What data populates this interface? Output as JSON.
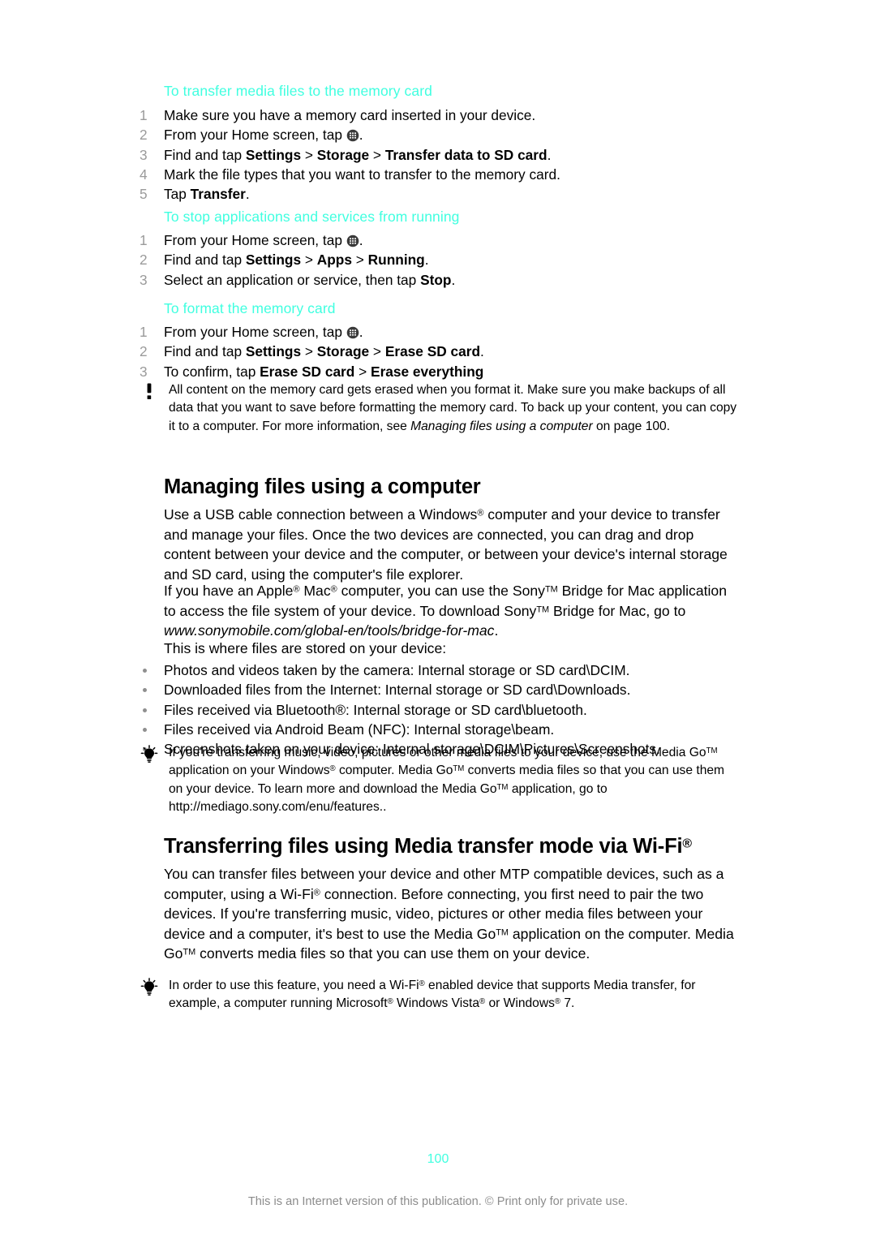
{
  "document": {
    "page_number": "100",
    "footer_note": "This is an Internet version of this publication. © Print only for private use.",
    "accent_color": "#40ffe0",
    "marker_color": "#9b9b9b"
  },
  "sections": [
    {
      "id": "transfer-media-files",
      "heading": "To transfer media files to the memory card",
      "type": "numbered",
      "steps": [
        {
          "num": "1",
          "text": "Make sure you have a memory card inserted in your device."
        },
        {
          "num": "2",
          "text": "From your Home screen, tap"
        },
        {
          "num": "3",
          "text": "Find and tap Settings > Storage > Transfer data to SD card."
        },
        {
          "num": "4",
          "text": "Mark the file types that you want to transfer to the memory card."
        },
        {
          "num": "5",
          "text": "Tap Transfer."
        }
      ]
    },
    {
      "id": "stop-applications",
      "heading": "To stop applications and services from running",
      "type": "numbered",
      "steps": [
        {
          "num": "1",
          "text": "From your Home screen, tap"
        },
        {
          "num": "2",
          "text": "Find and tap Settings > Apps > Running."
        },
        {
          "num": "3",
          "text": "Select an application or service, then tap Stop."
        }
      ]
    },
    {
      "id": "format-memory-card",
      "heading": "To format the memory card",
      "type": "numbered",
      "steps": [
        {
          "num": "1",
          "text": "From your Home screen, tap"
        },
        {
          "num": "2",
          "text": "Find and tap Settings > Storage > Erase SD card."
        },
        {
          "num": "3",
          "text": "To confirm, tap Erase SD card > Erase everything"
        }
      ]
    }
  ],
  "step_fragments": {
    "find_and_tap": "Find and tap ",
    "settings": "Settings",
    "storage": "Storage",
    "apps": "Apps",
    "running": "Running",
    "transfer_data_to_sd_card": "Transfer data to SD card",
    "erase_sd_card": "Erase SD card",
    "erase_everything": "Erase everything",
    "tap": "Tap ",
    "transfer": "Transfer",
    "from_home_screen": "From your Home screen, tap ",
    "period": ".",
    "separator": " > ",
    "select_app_prefix": "Select an application or service, then tap ",
    "stop": "Stop",
    "to_confirm_prefix": "To confirm, tap ",
    "make_sure_memory_card": "Make sure you have a memory card inserted in your device.",
    "mark_file_types": "Mark the file types that you want to transfer to the memory card."
  },
  "warning_note": {
    "icon": "exclamation-icon",
    "part1": "All content on the memory card gets erased when you format it. Make sure you make backups of all data that you want to save before formatting the memory card. To back up your content, you can copy it to a computer. For more information, see ",
    "italic": "Managing files using a computer",
    "part2": " on page 100."
  },
  "main_heading": "Managing files using a computer",
  "paragraphs": {
    "p1_a": "Use a USB cable connection between a Windows",
    "p1_b": " computer and your device to transfer and manage your files. Once the two devices are connected, you can drag and drop content between your device and the computer, or between your device's internal storage and SD card, using the computer's file explorer.",
    "p2_a": "If you have an Apple",
    "p2_b": " Mac",
    "p2_c": " computer, you can use the Sony",
    "p2_d": " Bridge for Mac application to access the file system of your device. To download Sony",
    "p2_e": " Bridge for Mac, go to ",
    "p2_url": "www.sonymobile.com/global-en/tools/bridge-for-mac",
    "p2_end": ".",
    "p3": "This is where files are stored on your device:"
  },
  "storage_bullets": [
    "Photos and videos taken by the camera: Internal storage or SD card\\DCIM.",
    "Downloaded files from the Internet: Internal storage or SD card\\Downloads.",
    "Files received via Bluetooth®: Internal storage or SD card\\bluetooth.",
    "Files received via Android Beam (NFC): Internal storage\\beam.",
    "Screenshots taken on your device: Internal storage\\DCIM\\Pictures\\Screenshots."
  ],
  "tip1": {
    "icon": "lightbulb-icon",
    "a": "If you're transferring music, video, pictures or other media files to your device, use the Media Go",
    "b": " application on your Windows",
    "c": " computer. Media Go",
    "d": " converts media files so that you can use them on your device. To learn more and download the Media Go",
    "e": " application, go to http://mediago.sony.com/enu/features.."
  },
  "heading2": {
    "a": "Transferring files using Media transfer mode via Wi-Fi",
    "reg": "®"
  },
  "paragraph4": {
    "a": "You can transfer files between your device and other MTP compatible devices, such as a computer, using a Wi-Fi",
    "b": " connection. Before connecting, you first need to pair the two devices. If you're transferring music, video, pictures or other media files between your device and a computer, it's best to use the Media Go",
    "c": " application on the computer. Media Go",
    "d": " converts media files so that you can use them on your device."
  },
  "tip2": {
    "icon": "lightbulb-icon",
    "a": "In order to use this feature, you need a Wi-Fi",
    "b": " enabled device that supports Media transfer, for example, a computer running Microsoft",
    "c": " Windows Vista",
    "d": " or Windows",
    "e": " 7."
  },
  "symbols": {
    "registered": "®",
    "trademark": "TM"
  }
}
